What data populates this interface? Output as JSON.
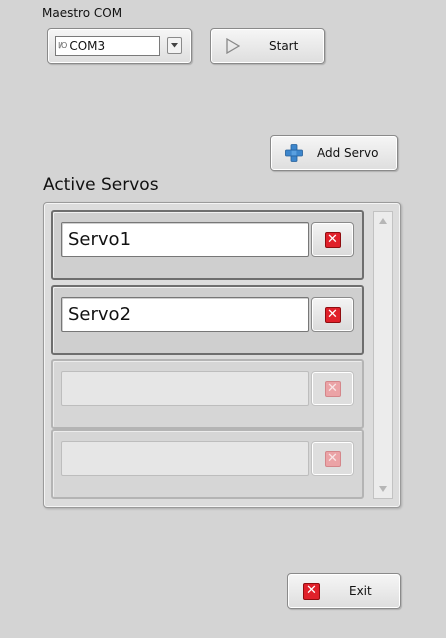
{
  "maestro_com": {
    "label": "Maestro COM",
    "io_glyph": "I/O",
    "selected_port": "COM3"
  },
  "start_button": {
    "label": "Start"
  },
  "add_servo_button": {
    "label": "Add Servo"
  },
  "active_servos": {
    "title": "Active Servos",
    "slots": [
      {
        "name": "Servo1",
        "enabled": true
      },
      {
        "name": "Servo2",
        "enabled": true
      },
      {
        "name": "",
        "enabled": false
      },
      {
        "name": "",
        "enabled": false
      }
    ]
  },
  "exit_button": {
    "label": "Exit"
  },
  "colors": {
    "background": "#d4d4d4",
    "delete_red": "#e0202a",
    "add_blue": "#3d86cc"
  },
  "icons": [
    "io-icon",
    "dropdown-arrow-icon",
    "play-icon",
    "plus-icon",
    "delete-x-icon",
    "scroll-up-icon",
    "scroll-down-icon"
  ]
}
